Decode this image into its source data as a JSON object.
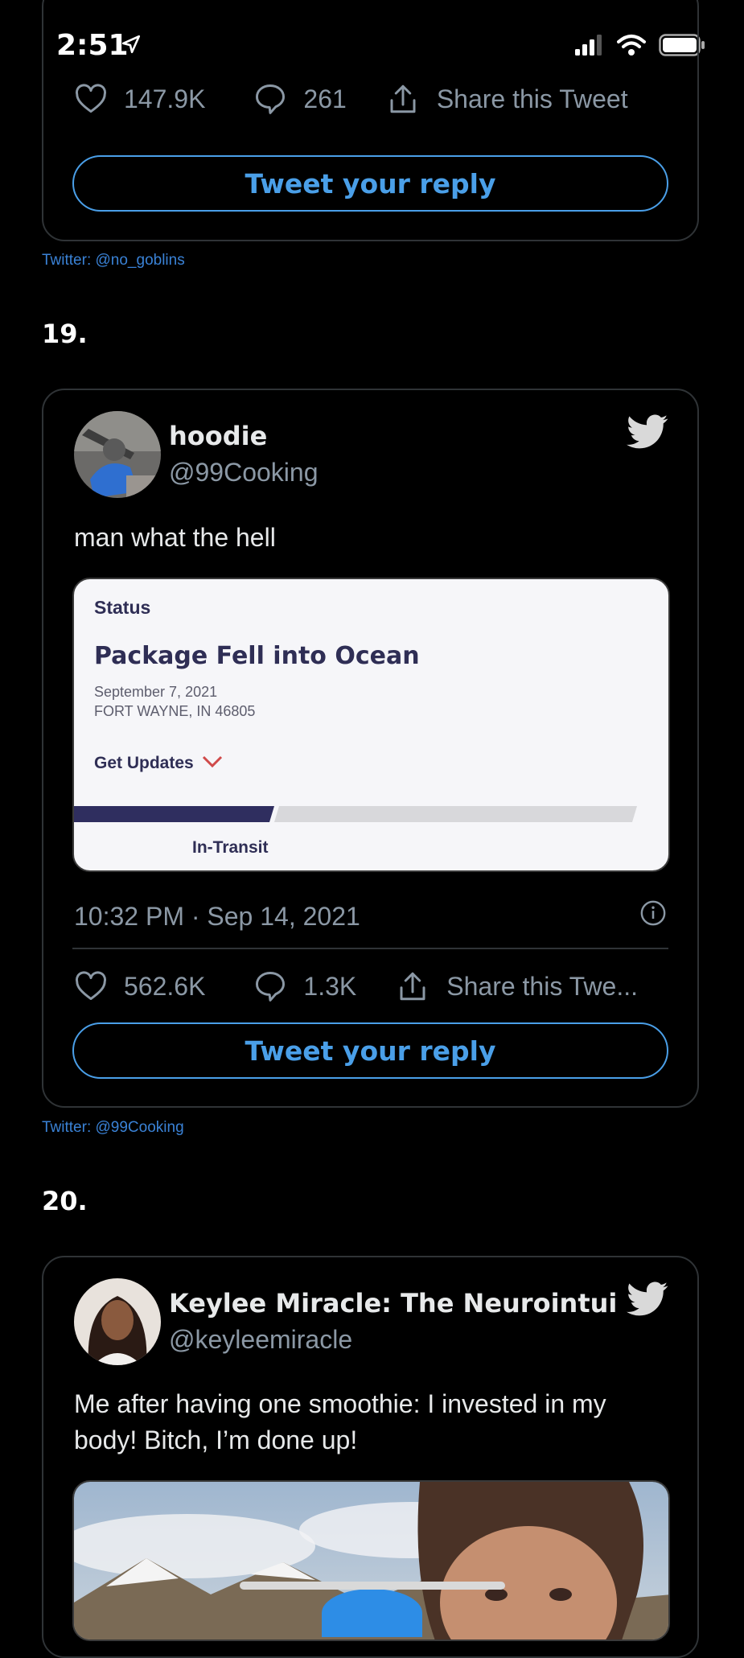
{
  "status_bar": {
    "time": "2:51",
    "icons": [
      "location-arrow-icon",
      "signal-icon",
      "wifi-icon",
      "battery-icon"
    ]
  },
  "tweets": [
    {
      "likes": "147.9K",
      "replies": "261",
      "share_label": "Share this Tweet",
      "reply_label": "Tweet your reply",
      "source": "Twitter: @no_goblins"
    },
    {
      "number": "19.",
      "author_name": "hoodie",
      "author_handle": "@99Cooking",
      "text": "man what the hell",
      "media": {
        "status_label": "Status",
        "title": "Package Fell into Ocean",
        "date": "September 7, 2021",
        "location": "FORT WAYNE, IN 46805",
        "updates_label": "Get Updates",
        "progress_label": "In-Transit"
      },
      "timestamp": "10:32 PM · Sep 14, 2021",
      "likes": "562.6K",
      "replies": "1.3K",
      "share_label": "Share this Twe...",
      "reply_label": "Tweet your reply",
      "source": "Twitter: @99Cooking"
    },
    {
      "number": "20.",
      "author_name": "Keylee Miracle: The Neurointuitive",
      "author_handle": "@keyleemiracle",
      "text": "Me after having one smoothie: I invested in my body! Bitch, I’m done up!"
    }
  ],
  "colors": {
    "accent": "#4a9fe8",
    "muted": "#8b98a5",
    "border": "#2f3336",
    "link": "#3a82d6"
  }
}
